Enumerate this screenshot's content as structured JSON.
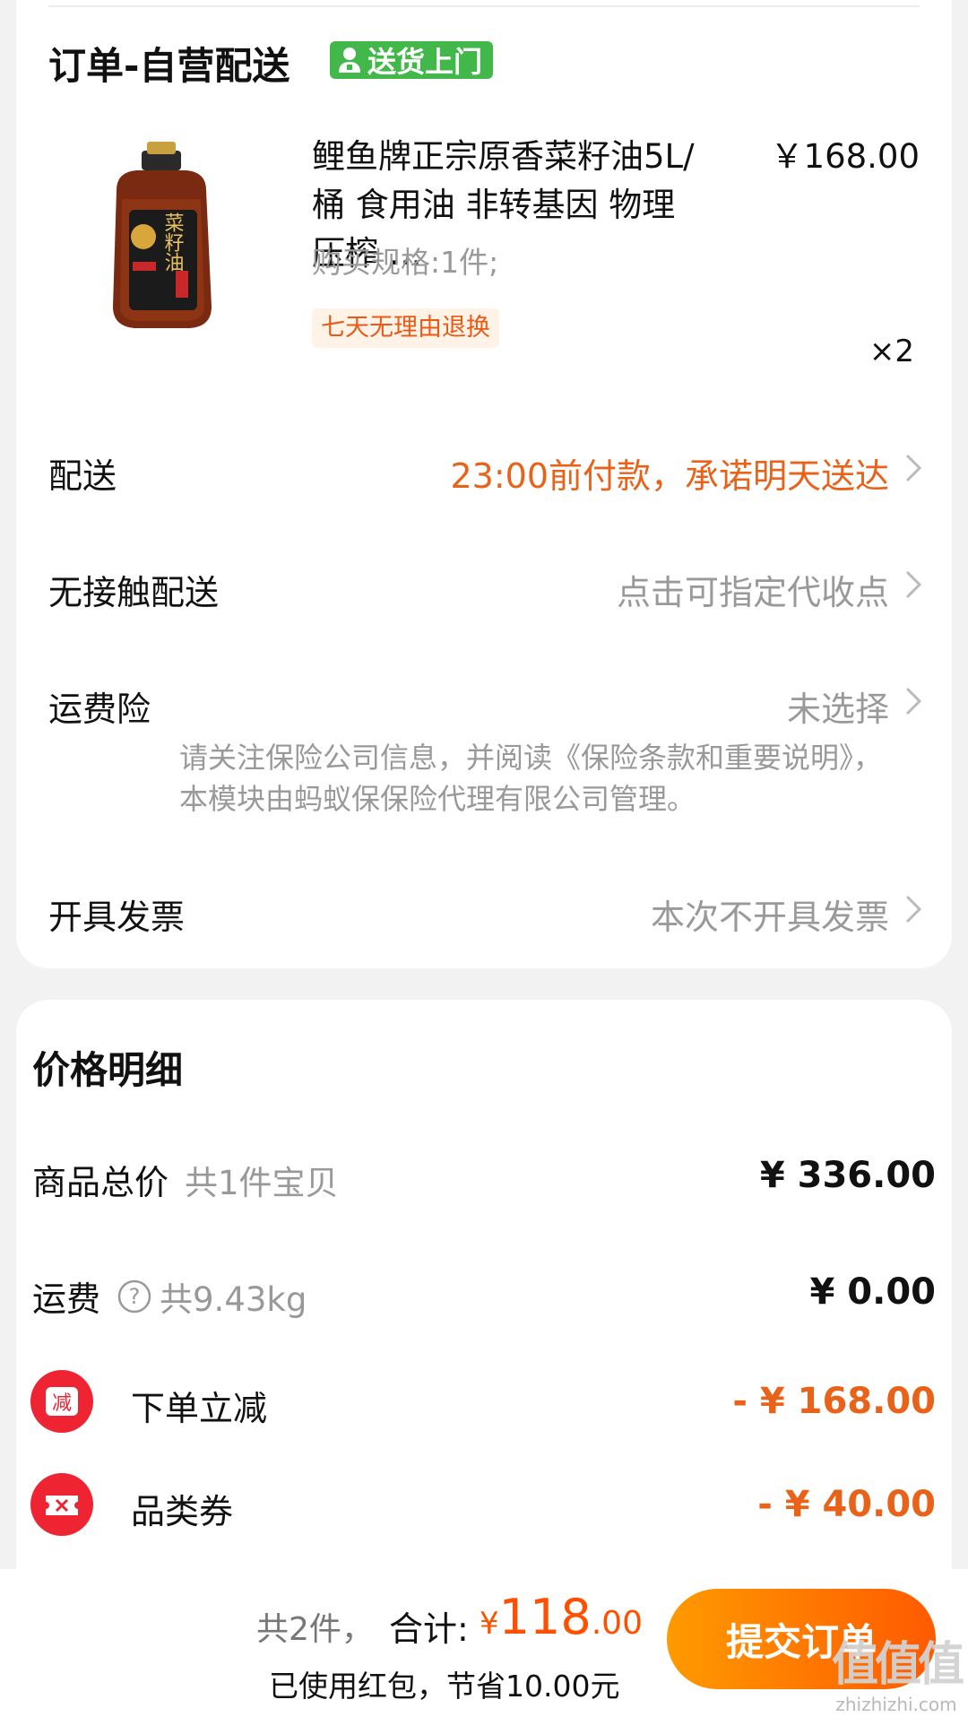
{
  "order": {
    "title": "订单-自营配送",
    "badge": "送货上门",
    "product": {
      "title": "鲤鱼牌正宗原香菜籽油5L/桶 食用油 非转基因 物理压榨 …",
      "price": "￥168.00",
      "spec": "购买规格:1件;",
      "return_tag": "七天无理由退换",
      "quantity": "×2",
      "image_label": "菜籽油"
    },
    "rows": {
      "delivery": {
        "label": "配送",
        "value": "23:00前付款，承诺明天送达"
      },
      "contactless": {
        "label": "无接触配送",
        "value": "点击可指定代收点"
      },
      "shipping_insurance": {
        "label": "运费险",
        "value": "未选择"
      },
      "insurance_note": "请关注保险公司信息，并阅读《保险条款和重要说明》，本模块由蚂蚁保保险代理有限公司管理。",
      "invoice": {
        "label": "开具发票",
        "value": "本次不开具发票"
      }
    }
  },
  "price_detail": {
    "title": "价格明细",
    "goods_total": {
      "label": "商品总价",
      "sub": "共1件宝贝",
      "value": "¥ 336.00"
    },
    "freight": {
      "label": "运费",
      "sub": "共9.43kg",
      "value": "¥ 0.00"
    },
    "order_discount": {
      "label": "下单立减",
      "icon_text": "减",
      "value": "- ¥ 168.00"
    },
    "category_coupon": {
      "label": "品类券",
      "value": "- ¥ 40.00"
    }
  },
  "bottom_bar": {
    "count": "共2件，",
    "total_label": "合计:",
    "currency": "¥",
    "total_int": "118",
    "total_dec": ".00",
    "saved": "已使用红包，节省10.00元",
    "submit": "提交订单",
    "watermark": "值值值",
    "watermark_url": "zhizhizhi.com"
  },
  "colors": {
    "accent": "#e8621a",
    "brand_orange": "#ff5000",
    "badge_green": "#43b84a",
    "discount_red": "#ee2432"
  }
}
